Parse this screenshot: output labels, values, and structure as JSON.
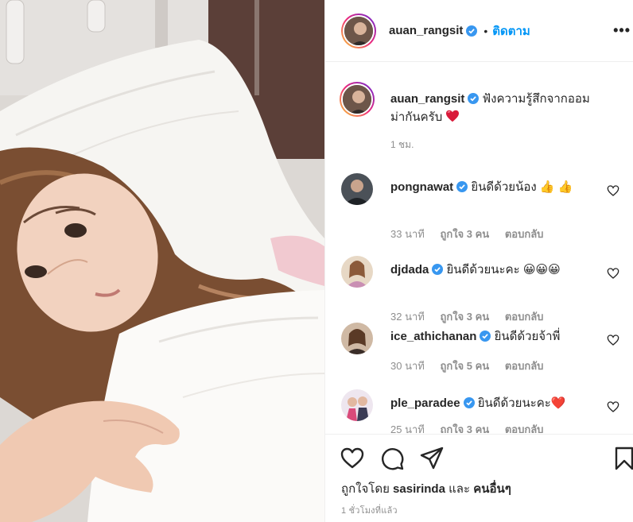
{
  "post": {
    "author": "auan_rangsit",
    "follow_label": "ติดตาม",
    "separator": "•",
    "more_label": "•••",
    "caption_user": "auan_rangsit",
    "caption_text_line1": "ฟังความรู้สึกจากออม",
    "caption_text_line2": "ม่ากันครับ",
    "caption_time": "1 ชม.",
    "verified_color": "#3897f0",
    "follow_color": "#0095f6"
  },
  "comments": [
    {
      "user": "pongnawat",
      "text": "ยินดีด้วยน้อง",
      "emoji": "👍 👍",
      "time": "33 นาที",
      "likes": "ถูกใจ 3 คน",
      "reply": "ตอบกลับ"
    },
    {
      "user": "djdada",
      "text": "ยินดีด้วยนะคะ",
      "emoji": "😀😀😀",
      "time": "32 นาที",
      "likes": "ถูกใจ 3 คน",
      "reply": "ตอบกลับ"
    },
    {
      "user": "ice_athichanan",
      "text": "ยินดีด้วยจ้าพี่",
      "emoji": "",
      "time": "30 นาที",
      "likes": "ถูกใจ 5 คน",
      "reply": "ตอบกลับ"
    },
    {
      "user": "ple_paradee",
      "text": "ยินดีด้วยนะคะ",
      "emoji": "❤️",
      "time": "25 นาที",
      "likes": "ถูกใจ 3 คน",
      "reply": "ตอบกลับ"
    }
  ],
  "footer": {
    "liked_by_prefix": "ถูกใจโดย",
    "liked_by_user": "sasirinda",
    "and": "และ",
    "others": "คนอื่นๆ",
    "time_ago": "1 ชั่วโมงที่แล้ว"
  },
  "icons": {
    "like": "heart-icon",
    "comment": "comment-icon",
    "share": "share-icon",
    "save": "bookmark-icon"
  }
}
